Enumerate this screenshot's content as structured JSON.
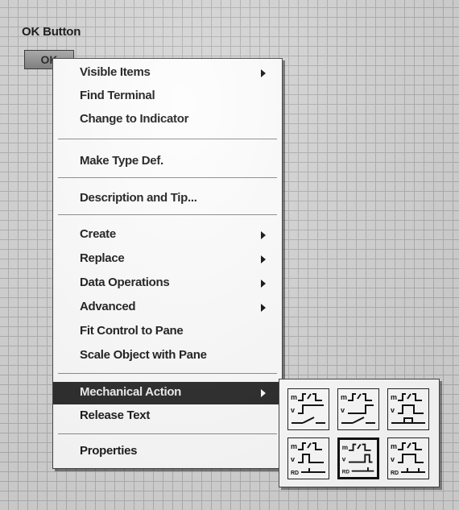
{
  "control": {
    "label": "OK Button",
    "button_text": "OK"
  },
  "context_menu": {
    "items": [
      {
        "label": "Visible Items",
        "submenu": true
      },
      {
        "label": "Find Terminal",
        "submenu": false
      },
      {
        "label": "Change to Indicator",
        "submenu": false
      },
      {
        "label": "Make Type Def.",
        "submenu": false
      },
      {
        "label": "Description and Tip...",
        "submenu": false
      },
      {
        "label": "Create",
        "submenu": true
      },
      {
        "label": "Replace",
        "submenu": true
      },
      {
        "label": "Data Operations",
        "submenu": true
      },
      {
        "label": "Advanced",
        "submenu": true
      },
      {
        "label": "Fit Control to Pane",
        "submenu": false
      },
      {
        "label": "Scale Object with Pane",
        "submenu": false
      },
      {
        "label": "Mechanical Action",
        "submenu": true,
        "highlighted": true
      },
      {
        "label": "Release Text",
        "submenu": false
      },
      {
        "label": "Properties",
        "submenu": false
      }
    ]
  },
  "mechanical_action_palette": {
    "icons": [
      {
        "name": "switch-when-pressed-icon",
        "selected": false
      },
      {
        "name": "switch-when-released-icon",
        "selected": false
      },
      {
        "name": "switch-until-released-icon",
        "selected": false
      },
      {
        "name": "latch-when-pressed-icon",
        "selected": false
      },
      {
        "name": "latch-when-released-icon",
        "selected": true
      },
      {
        "name": "latch-until-released-icon",
        "selected": false
      }
    ],
    "icon_text": {
      "m": "m",
      "v": "v",
      "rd": "RD"
    }
  }
}
